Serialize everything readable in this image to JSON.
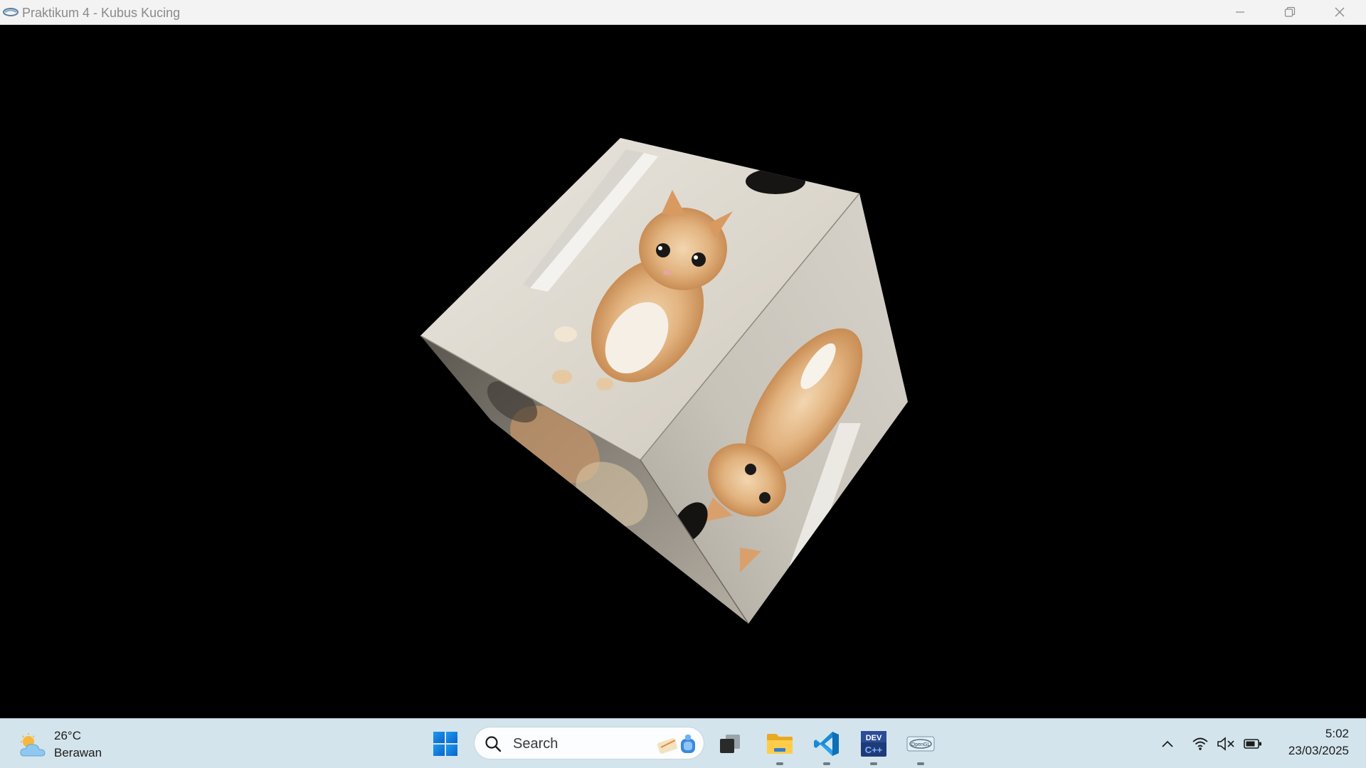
{
  "window": {
    "title": "Praktikum 4 - Kubus Kucing",
    "controls": [
      "minimize-icon",
      "restore-icon",
      "close-icon"
    ]
  },
  "scene": {
    "background_color": "#000000",
    "object": "textured-cube",
    "texture": "kitten-photo"
  },
  "taskbar": {
    "weather": {
      "temperature": "26°C",
      "condition": "Berawan",
      "icon": "partly-cloudy-icon"
    },
    "search": {
      "placeholder": "Search"
    },
    "pinned_apps": [
      {
        "name": "start",
        "icon": "windows-logo-icon"
      },
      {
        "name": "task-view",
        "icon": "task-view-icon"
      },
      {
        "name": "file-explorer",
        "icon": "folder-icon",
        "running": true
      },
      {
        "name": "vscode",
        "icon": "vscode-icon",
        "running": true
      },
      {
        "name": "dev-cpp",
        "icon": "dev-cpp-icon",
        "running": true
      },
      {
        "name": "opengl-app",
        "icon": "opengl-icon",
        "running": true
      }
    ],
    "tray": {
      "icons": [
        "chevron-up-icon",
        "wifi-icon",
        "speaker-muted-icon",
        "battery-icon"
      ],
      "time": "5:02",
      "date": "23/03/2025"
    }
  }
}
